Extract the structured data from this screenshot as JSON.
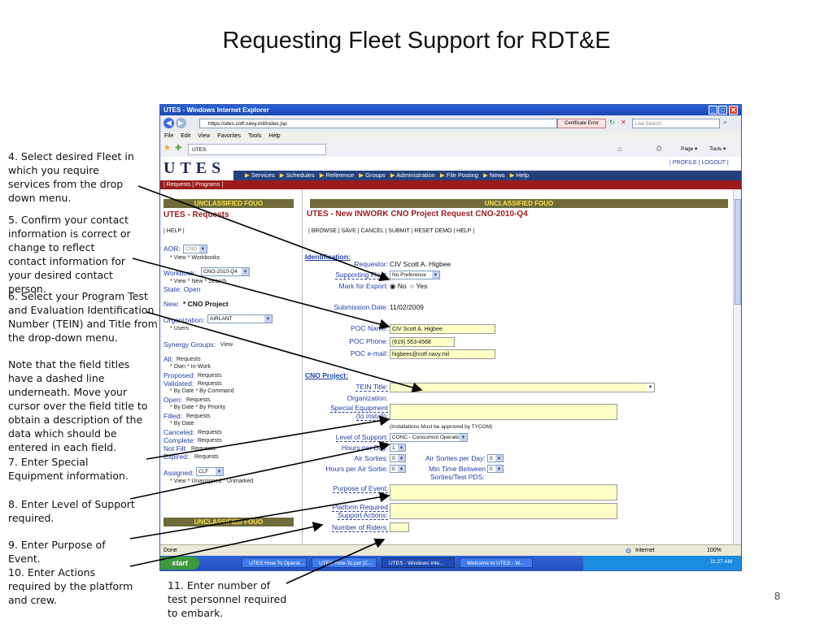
{
  "slide": {
    "title": "Requesting Fleet Support for RDT&E",
    "page_number": "8",
    "notes": [
      "4. Select desired Fleet in which you require services from the drop down menu.",
      "5. Confirm your contact information is correct or change to reflect  contact information for your desired contact person.",
      "6. Select your Program Test and Evaluation Identification Number (TEIN) and Title from the drop-down menu.",
      "Note that the field titles have a dashed line underneath.  Move your cursor over the field title to obtain a description of the data which should be entered in each field.",
      "7. Enter Special Equipment information.",
      "8. Enter Level of Support required.",
      "9. Enter Purpose of Event.",
      "10. Enter Actions required by the platform and crew.",
      "11. Enter number of test personnel required to embark."
    ]
  },
  "browser": {
    "window_title": "UTES - Windows Internet Explorer",
    "url": "https://utes.cotf.navy.mil/index.jsp",
    "cert_error": "Certificate Error",
    "search_placeholder": "Live Search",
    "menu": [
      "File",
      "Edit",
      "View",
      "Favorites",
      "Tools",
      "Help"
    ],
    "tab_title": "UTES",
    "toolbar_right": [
      "Page ▾",
      "Tools ▾"
    ],
    "status_left": "Done",
    "status_zone": "Internet",
    "zoom": "100%"
  },
  "taskbar": {
    "start": "start",
    "items": [
      "UTES How-To Operat...",
      "UTES How-To.ppt [C...",
      "UTES - Windows Inte...",
      "Welcome to UTES - W..."
    ],
    "clock": "11:27 AM"
  },
  "app": {
    "logo": "UTES",
    "top_links": [
      "PROFILE",
      "LOGOUT"
    ],
    "nav": [
      "Services",
      "Schedules",
      "Reference",
      "Groups",
      "Administration",
      "File Posting",
      "News",
      "Help"
    ],
    "subnav": "| Requests | Programs |",
    "banner": "UNCLASSIFIED FOUO",
    "banner_bottom": "UNCLASSIFIED FOUO"
  },
  "sidebar": {
    "title": "UTES - Requests",
    "help": "| HELP |",
    "aor_label": "AOR:",
    "aor_value": "CNO",
    "aor_links": "* View   * Workbooks",
    "workbook_label": "Workbook:",
    "workbook_value": "CNO-2010-Q4",
    "workbook_links": "* View   * New   * Search",
    "state": "State:  Open",
    "new_label": "New:",
    "new_value": "* CNO Project",
    "org_label": "Organization:",
    "org_value": "AIRLANT",
    "users": "* Users",
    "synergy_label": "Synergy Groups:",
    "synergy_value": "View",
    "status_groups": [
      {
        "label": "All:",
        "value": "Requests",
        "sub": "* Own   * In-Work"
      },
      {
        "label": "Proposed:",
        "value": "Requests",
        "sub": ""
      },
      {
        "label": "Validated:",
        "value": "Requests",
        "sub": "* By Date   * By Command"
      },
      {
        "label": "Open:",
        "value": "Requests",
        "sub": "* By Date   * By Priority"
      },
      {
        "label": "Filled:",
        "value": "Requests",
        "sub": "* By Date"
      },
      {
        "label": "Canceled:",
        "value": "Requests",
        "sub": ""
      },
      {
        "label": "Complete:",
        "value": "Requests",
        "sub": ""
      },
      {
        "label": "Not Fill:",
        "value": "Requests",
        "sub": ""
      },
      {
        "label": "Expired:",
        "value": "Requests",
        "sub": ""
      }
    ],
    "assigned_label": "Assigned:",
    "assigned_value": "CLF",
    "assigned_links": "* View   * Unassigned   * Unmarked"
  },
  "form": {
    "title": "UTES - New INWORK CNO Project Request CNO-2010-Q4",
    "actions": "| BROWSE | SAVE | CANCEL | SUBMIT | RESET DEMO | HELP |",
    "section_identification": "Identification:",
    "requestor_label": "Requestor:",
    "requestor_value": "CIV Scott A. Higbee",
    "fleet_label": "Supporting Fleet:",
    "fleet_value": "No Preference",
    "export_label": "Mark for Export:",
    "export_no": "No",
    "export_yes": "Yes",
    "submission_label": "Submission Date:",
    "submission_value": "11/02/2009",
    "poc_name_label": "POC Name:",
    "poc_name_value": "CIV Scott A. Higbee",
    "poc_phone_label": "POC Phone:",
    "poc_phone_value": "(619) 553-4568",
    "poc_email_label": "POC e-mail:",
    "poc_email_value": "higbees@cotf.navy.mil",
    "section_cno": "CNO Project:",
    "tein_label": "TEIN Title:",
    "org_label": "Organization:",
    "special_label_1": "Special Equipment",
    "special_label_2": "(to install):",
    "install_note": "(Installations Must be approved by TYCOM)",
    "support_label": "Level of Support:",
    "support_value": "CONC - Concurrent Operations",
    "hours_day_label": "Hours per Day:",
    "hours_day_value": "1",
    "air_sorties_label": "Air Sorties:",
    "air_sorties_value": "0",
    "air_sorties_day_label": "Air Sorties per Day:",
    "air_sorties_day_value": "0",
    "hours_sortie_label": "Hours per Air Sortie:",
    "hours_sortie_value": "0",
    "min_time_label_1": "Min Time Between",
    "min_time_label_2": "Sorties/Test PDS:",
    "min_time_value": "0",
    "purpose_label": "Purpose of Event:",
    "platform_label_1": "Platform Required",
    "platform_label_2": "Support Actions:",
    "riders_label": "Number of Riders:"
  }
}
